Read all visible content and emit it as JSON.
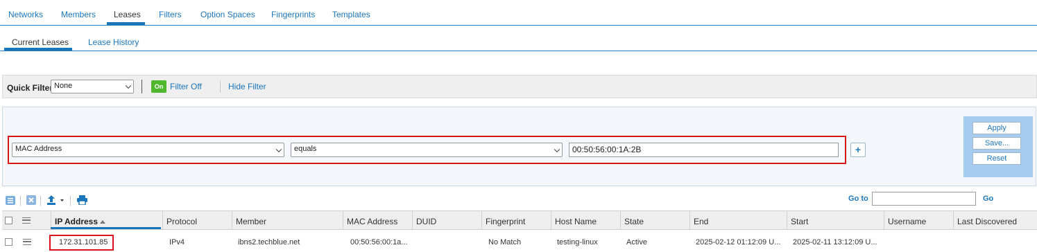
{
  "top_tabs": [
    "Networks",
    "Members",
    "Leases",
    "Filters",
    "Option Spaces",
    "Fingerprints",
    "Templates"
  ],
  "top_active": "Leases",
  "sub_tabs": [
    "Current Leases",
    "Lease History"
  ],
  "sub_active": "Current Leases",
  "quick_filter": {
    "label": "Quick Filter",
    "value": "None",
    "toggle": "On",
    "filter_off": "Filter Off",
    "hide_filter": "Hide Filter"
  },
  "filter_rule": {
    "field": "MAC Address",
    "operator": "equals",
    "value": "00:50:56:00:1A:2B",
    "add_label": "+"
  },
  "filter_actions": {
    "apply": "Apply",
    "save": "Save...",
    "reset": "Reset"
  },
  "goto": {
    "label": "Go to",
    "value": "",
    "go": "Go"
  },
  "columns": [
    "IP Address",
    "Protocol",
    "Member",
    "MAC Address",
    "DUID",
    "Fingerprint",
    "Host Name",
    "State",
    "End",
    "Start",
    "Username",
    "Last Discovered"
  ],
  "sorted_column": "IP Address",
  "rows": [
    {
      "ip": "172.31.101.85",
      "protocol": "IPv4",
      "member": "ibns2.techblue.net",
      "mac": "00:50:56:00:1a...",
      "duid": "",
      "fingerprint": "No Match",
      "host": "testing-linux",
      "state": "Active",
      "end": "2025-02-12 01:12:09 U...",
      "start": "2025-02-11 13:12:09 U...",
      "username": "",
      "last_discovered": ""
    }
  ],
  "colors": {
    "link": "#1b75bb",
    "highlight": "#d8141c",
    "toggle_on": "#4fb82e",
    "action_panel": "#a7ccf0"
  }
}
